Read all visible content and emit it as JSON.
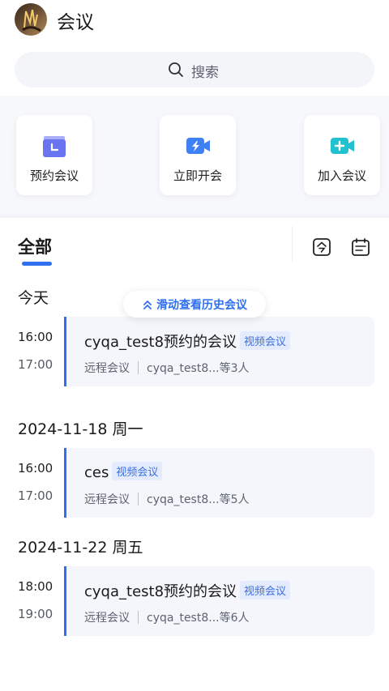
{
  "header": {
    "title": "会议",
    "avatar_icon": "user-avatar"
  },
  "search": {
    "placeholder": "搜索"
  },
  "quick_actions": [
    {
      "label": "预约会议",
      "icon": "calendar-clock-icon",
      "color": "#6b74f0"
    },
    {
      "label": "立即开会",
      "icon": "video-lightning-icon",
      "color": "#3f80f5"
    },
    {
      "label": "加入会议",
      "icon": "video-plus-icon",
      "color": "#22c1cf"
    }
  ],
  "tabs": {
    "active": "全部",
    "accent": "#2f6ff0"
  },
  "history_hint": "滑动查看历史会议",
  "groups": [
    {
      "date": "今天",
      "meetings": [
        {
          "start": "16:00",
          "end": "17:00",
          "title": "cyqa_test8预约的会议",
          "tag": "视频会议",
          "location": "远程会议",
          "participants": "cyqa_test8...等3人"
        }
      ]
    },
    {
      "date": "2024-11-18 周一",
      "meetings": [
        {
          "start": "16:00",
          "end": "17:00",
          "title": "ces",
          "tag": "视频会议",
          "location": "远程会议",
          "participants": "cyqa_test8...等5人"
        }
      ]
    },
    {
      "date": "2024-11-22 周五",
      "meetings": [
        {
          "start": "18:00",
          "end": "19:00",
          "title": "cyqa_test8预约的会议",
          "tag": "视频会议",
          "location": "远程会议",
          "participants": "cyqa_test8...等6人"
        }
      ]
    }
  ]
}
